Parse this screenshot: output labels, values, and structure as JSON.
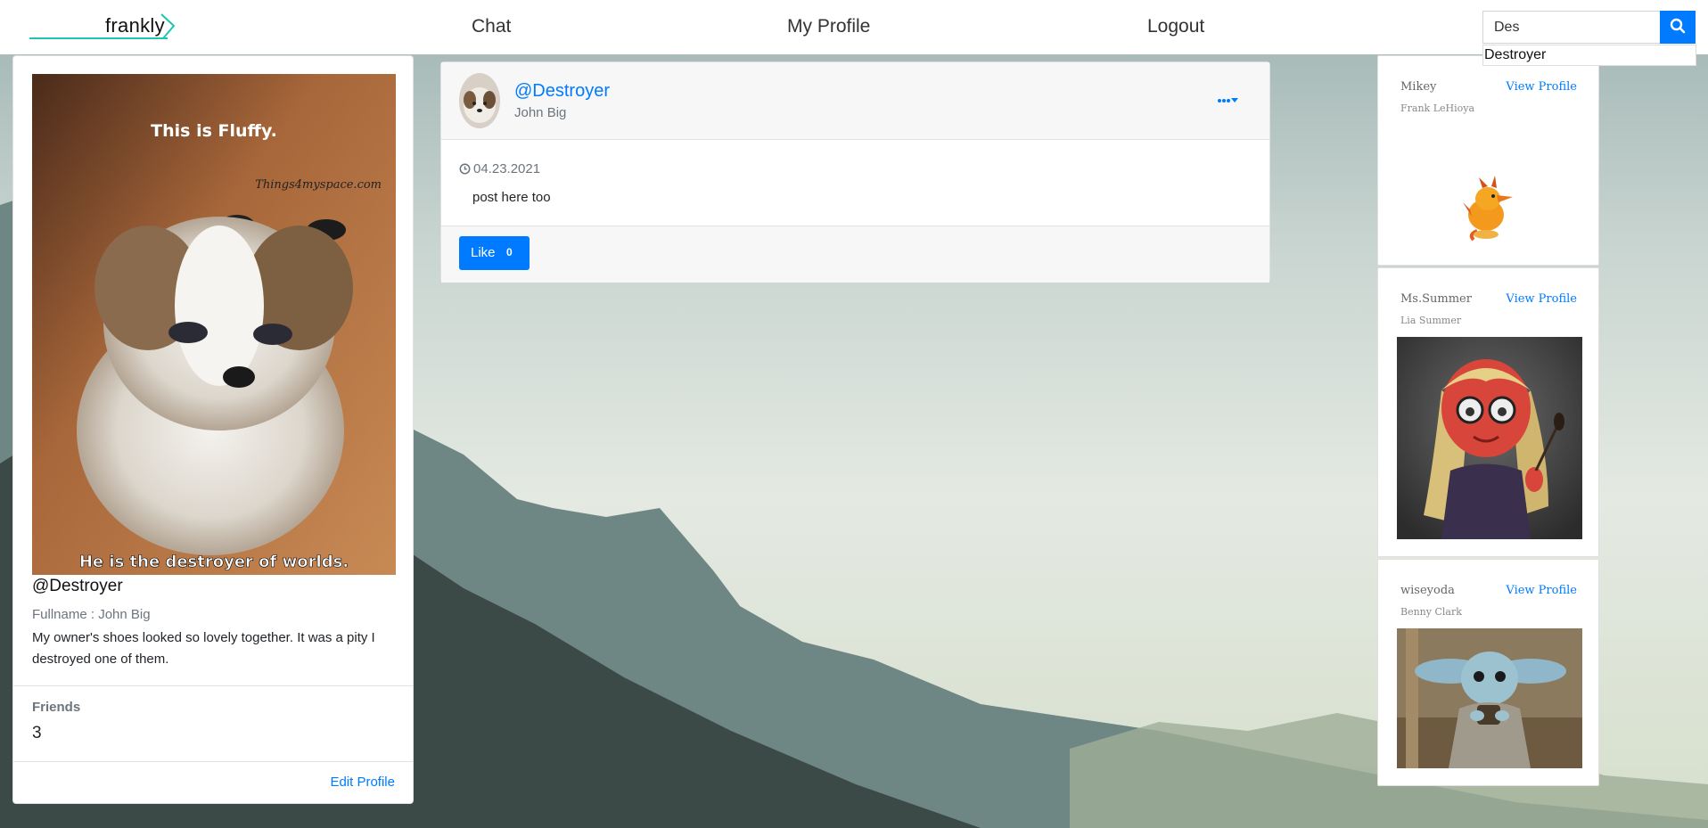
{
  "navbar": {
    "brand": "frankly",
    "links": {
      "chat": "Chat",
      "profile": "My Profile",
      "logout": "Logout"
    },
    "search": {
      "value": "Des",
      "suggestion": "Destroyer"
    },
    "accent_color": "#007bff"
  },
  "profile": {
    "image_text_top": "This is Fluffy.",
    "image_watermark": "Things4myspace.com",
    "image_text_bottom": "He is the destroyer of worlds.",
    "handle": "@Destroyer",
    "fullname": "Fullname : John Big",
    "bio": "My owner's shoes looked so lovely together. It was a pity I destroyed one of them.",
    "friends_label": "Friends",
    "friends_count": "3",
    "edit_label": "Edit Profile"
  },
  "post": {
    "handle": "@Destroyer",
    "name": "John Big",
    "menu_icon": "ellipsis-caret-icon",
    "date": "04.23.2021",
    "text": "post here too",
    "like_label": "Like",
    "like_count": "0"
  },
  "friends": [
    {
      "username": "Mikey",
      "name": "Frank LeHioya",
      "view_label": "View Profile"
    },
    {
      "username": "Ms.Summer",
      "name": "Lia Summer",
      "view_label": "View Profile"
    },
    {
      "username": "wiseyoda",
      "name": "Benny Clark",
      "view_label": "View Profile"
    }
  ]
}
